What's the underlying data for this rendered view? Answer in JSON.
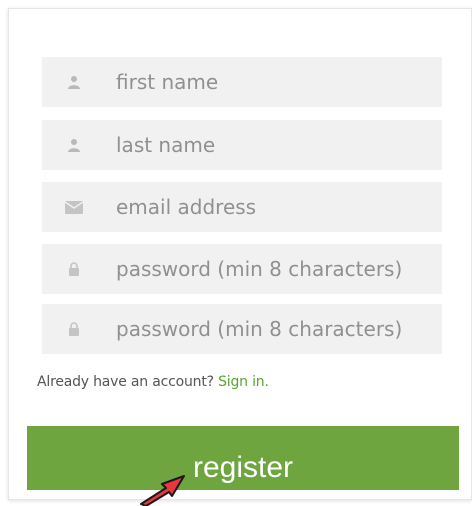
{
  "form": {
    "fields": [
      {
        "placeholder": "first name",
        "icon": "user-icon"
      },
      {
        "placeholder": "last name",
        "icon": "user-icon"
      },
      {
        "placeholder": "email address",
        "icon": "envelope-icon"
      },
      {
        "placeholder": "password (min 8 characters)",
        "icon": "lock-icon"
      },
      {
        "placeholder": "password (min 8 characters)",
        "icon": "lock-icon"
      }
    ],
    "have_account_text": "Already have an account?",
    "sign_in_link": "Sign in.",
    "register_label": "register"
  },
  "colors": {
    "field_bg": "#f1f1f1",
    "icon": "#b9b9b9",
    "accent_green": "#6ea53e",
    "link_green": "#55a532",
    "annotation_arrow": "#e8383d"
  }
}
